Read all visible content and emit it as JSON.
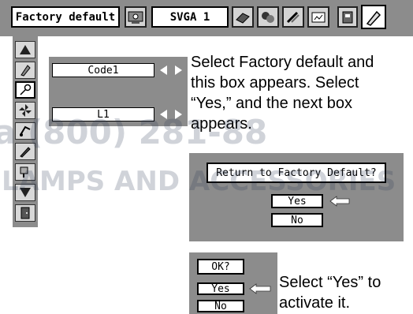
{
  "menu_bar": {
    "factory_default_tab": "Factory default",
    "source_tab": "SVGA 1",
    "icons": [
      "pc-adjust-icon",
      "image-select-icon",
      "image-adjust-icon",
      "screen-icon",
      "sound-icon",
      "setting-icon"
    ]
  },
  "sidebar": {
    "icons": [
      "up-arrow-icon",
      "eraser-icon",
      "key-icon",
      "fan-off-icon",
      "filter-icon",
      "pen-icon",
      "brush-icon",
      "down-arrow-icon",
      "exit-door-icon"
    ]
  },
  "code_panel": {
    "code_value": "Code1",
    "level_value": "L1"
  },
  "description_1": [
    "Select Factory default and",
    "this box appears.  Select",
    "“Yes,” and the next box",
    "appears."
  ],
  "confirm_dialog": {
    "question": "Return to Factory Default?",
    "yes_label": "Yes",
    "no_label": "No"
  },
  "ok_dialog": {
    "question": "OK?",
    "yes_label": "Yes",
    "no_label": "No"
  },
  "description_2": [
    "Select “Yes” to",
    "activate it."
  ],
  "watermark": {
    "line1": "a (800) 281-88",
    "line2": "LAMPS AND ACCESSORIES"
  },
  "colors": {
    "panel_gray": "#8c8c8c",
    "field_white": "#ffffff"
  }
}
